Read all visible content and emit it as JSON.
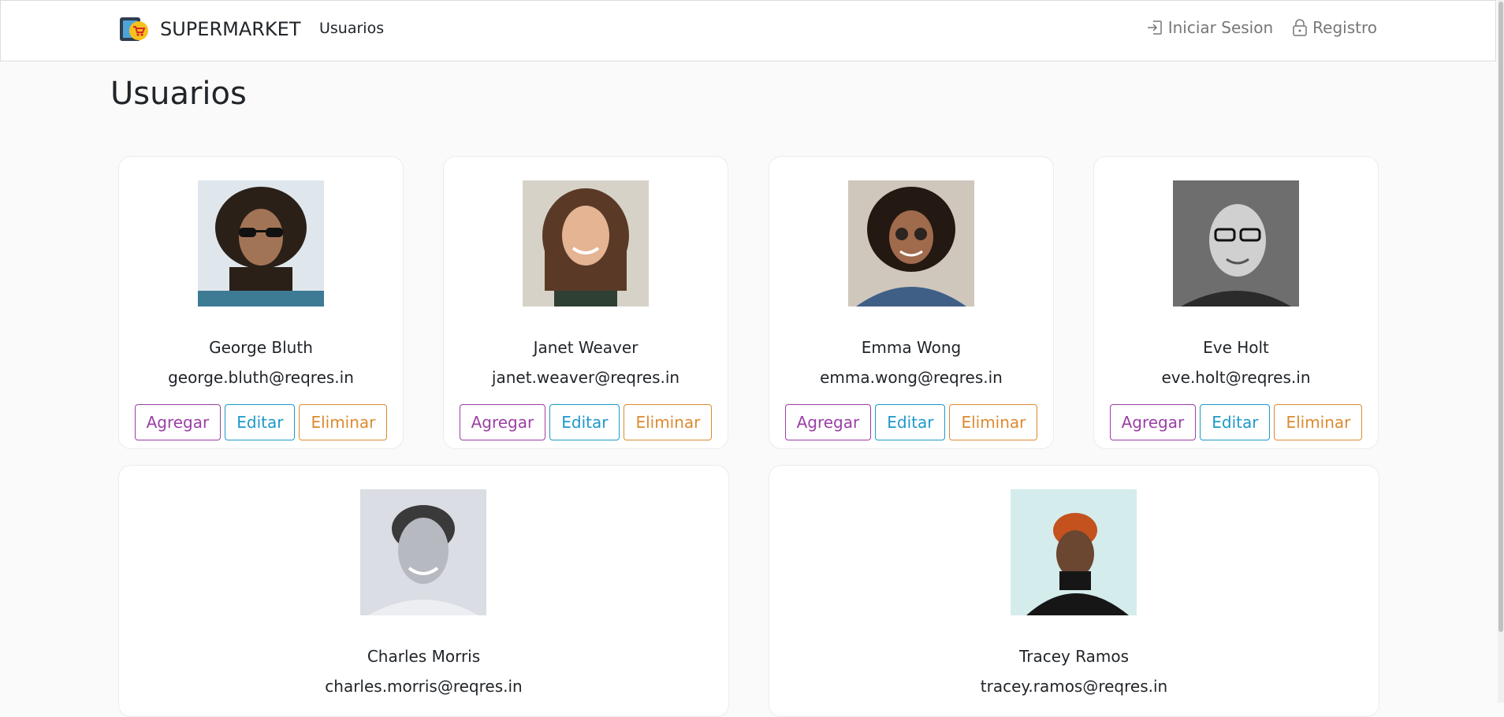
{
  "navbar": {
    "brand": "SUPERMARKET",
    "link": "Usuarios",
    "login": "Iniciar Sesion",
    "register": "Registro"
  },
  "page": {
    "title": "Usuarios"
  },
  "buttons": {
    "add": "Agregar",
    "edit": "Editar",
    "delete": "Eliminar"
  },
  "users": [
    {
      "name": "George Bluth",
      "email": "george.bluth@reqres.in"
    },
    {
      "name": "Janet Weaver",
      "email": "janet.weaver@reqres.in"
    },
    {
      "name": "Emma Wong",
      "email": "emma.wong@reqres.in"
    },
    {
      "name": "Eve Holt",
      "email": "eve.holt@reqres.in"
    },
    {
      "name": "Charles Morris",
      "email": "charles.morris@reqres.in"
    },
    {
      "name": "Tracey Ramos",
      "email": "tracey.ramos@reqres.in"
    }
  ],
  "colors": {
    "add": "#9b3fa6",
    "edit": "#1d99c9",
    "delete": "#dc8a30"
  }
}
